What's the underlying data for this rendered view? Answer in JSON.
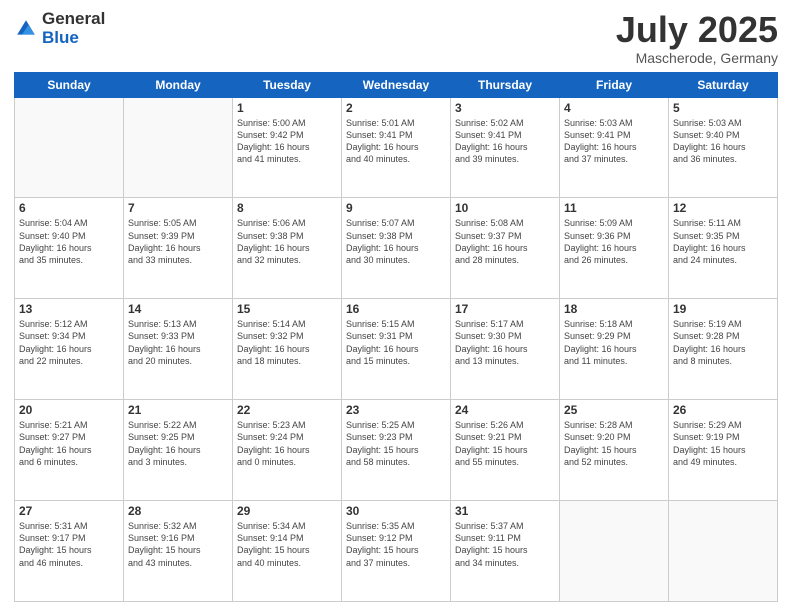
{
  "header": {
    "logo_general": "General",
    "logo_blue": "Blue",
    "month_title": "July 2025",
    "subtitle": "Mascherode, Germany"
  },
  "days_of_week": [
    "Sunday",
    "Monday",
    "Tuesday",
    "Wednesday",
    "Thursday",
    "Friday",
    "Saturday"
  ],
  "weeks": [
    [
      {
        "day": "",
        "info": ""
      },
      {
        "day": "",
        "info": ""
      },
      {
        "day": "1",
        "info": "Sunrise: 5:00 AM\nSunset: 9:42 PM\nDaylight: 16 hours\nand 41 minutes."
      },
      {
        "day": "2",
        "info": "Sunrise: 5:01 AM\nSunset: 9:41 PM\nDaylight: 16 hours\nand 40 minutes."
      },
      {
        "day": "3",
        "info": "Sunrise: 5:02 AM\nSunset: 9:41 PM\nDaylight: 16 hours\nand 39 minutes."
      },
      {
        "day": "4",
        "info": "Sunrise: 5:03 AM\nSunset: 9:41 PM\nDaylight: 16 hours\nand 37 minutes."
      },
      {
        "day": "5",
        "info": "Sunrise: 5:03 AM\nSunset: 9:40 PM\nDaylight: 16 hours\nand 36 minutes."
      }
    ],
    [
      {
        "day": "6",
        "info": "Sunrise: 5:04 AM\nSunset: 9:40 PM\nDaylight: 16 hours\nand 35 minutes."
      },
      {
        "day": "7",
        "info": "Sunrise: 5:05 AM\nSunset: 9:39 PM\nDaylight: 16 hours\nand 33 minutes."
      },
      {
        "day": "8",
        "info": "Sunrise: 5:06 AM\nSunset: 9:38 PM\nDaylight: 16 hours\nand 32 minutes."
      },
      {
        "day": "9",
        "info": "Sunrise: 5:07 AM\nSunset: 9:38 PM\nDaylight: 16 hours\nand 30 minutes."
      },
      {
        "day": "10",
        "info": "Sunrise: 5:08 AM\nSunset: 9:37 PM\nDaylight: 16 hours\nand 28 minutes."
      },
      {
        "day": "11",
        "info": "Sunrise: 5:09 AM\nSunset: 9:36 PM\nDaylight: 16 hours\nand 26 minutes."
      },
      {
        "day": "12",
        "info": "Sunrise: 5:11 AM\nSunset: 9:35 PM\nDaylight: 16 hours\nand 24 minutes."
      }
    ],
    [
      {
        "day": "13",
        "info": "Sunrise: 5:12 AM\nSunset: 9:34 PM\nDaylight: 16 hours\nand 22 minutes."
      },
      {
        "day": "14",
        "info": "Sunrise: 5:13 AM\nSunset: 9:33 PM\nDaylight: 16 hours\nand 20 minutes."
      },
      {
        "day": "15",
        "info": "Sunrise: 5:14 AM\nSunset: 9:32 PM\nDaylight: 16 hours\nand 18 minutes."
      },
      {
        "day": "16",
        "info": "Sunrise: 5:15 AM\nSunset: 9:31 PM\nDaylight: 16 hours\nand 15 minutes."
      },
      {
        "day": "17",
        "info": "Sunrise: 5:17 AM\nSunset: 9:30 PM\nDaylight: 16 hours\nand 13 minutes."
      },
      {
        "day": "18",
        "info": "Sunrise: 5:18 AM\nSunset: 9:29 PM\nDaylight: 16 hours\nand 11 minutes."
      },
      {
        "day": "19",
        "info": "Sunrise: 5:19 AM\nSunset: 9:28 PM\nDaylight: 16 hours\nand 8 minutes."
      }
    ],
    [
      {
        "day": "20",
        "info": "Sunrise: 5:21 AM\nSunset: 9:27 PM\nDaylight: 16 hours\nand 6 minutes."
      },
      {
        "day": "21",
        "info": "Sunrise: 5:22 AM\nSunset: 9:25 PM\nDaylight: 16 hours\nand 3 minutes."
      },
      {
        "day": "22",
        "info": "Sunrise: 5:23 AM\nSunset: 9:24 PM\nDaylight: 16 hours\nand 0 minutes."
      },
      {
        "day": "23",
        "info": "Sunrise: 5:25 AM\nSunset: 9:23 PM\nDaylight: 15 hours\nand 58 minutes."
      },
      {
        "day": "24",
        "info": "Sunrise: 5:26 AM\nSunset: 9:21 PM\nDaylight: 15 hours\nand 55 minutes."
      },
      {
        "day": "25",
        "info": "Sunrise: 5:28 AM\nSunset: 9:20 PM\nDaylight: 15 hours\nand 52 minutes."
      },
      {
        "day": "26",
        "info": "Sunrise: 5:29 AM\nSunset: 9:19 PM\nDaylight: 15 hours\nand 49 minutes."
      }
    ],
    [
      {
        "day": "27",
        "info": "Sunrise: 5:31 AM\nSunset: 9:17 PM\nDaylight: 15 hours\nand 46 minutes."
      },
      {
        "day": "28",
        "info": "Sunrise: 5:32 AM\nSunset: 9:16 PM\nDaylight: 15 hours\nand 43 minutes."
      },
      {
        "day": "29",
        "info": "Sunrise: 5:34 AM\nSunset: 9:14 PM\nDaylight: 15 hours\nand 40 minutes."
      },
      {
        "day": "30",
        "info": "Sunrise: 5:35 AM\nSunset: 9:12 PM\nDaylight: 15 hours\nand 37 minutes."
      },
      {
        "day": "31",
        "info": "Sunrise: 5:37 AM\nSunset: 9:11 PM\nDaylight: 15 hours\nand 34 minutes."
      },
      {
        "day": "",
        "info": ""
      },
      {
        "day": "",
        "info": ""
      }
    ]
  ]
}
